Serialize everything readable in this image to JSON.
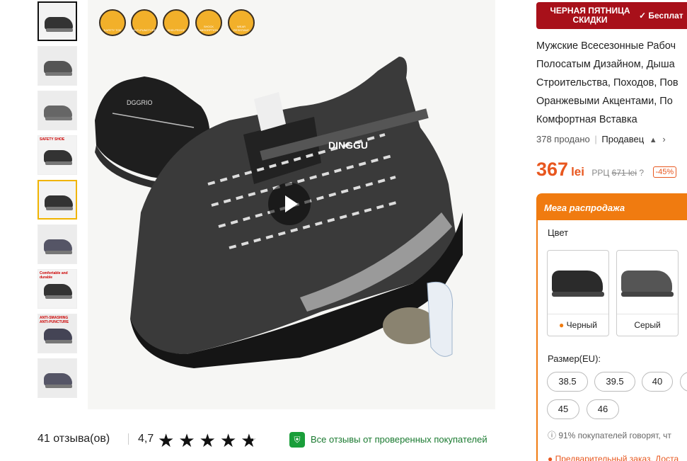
{
  "thumbnails": [
    {
      "label": ""
    },
    {
      "label": ""
    },
    {
      "label": ""
    },
    {
      "label": "SAFETY SHOE"
    },
    {
      "label": ""
    },
    {
      "label": ""
    },
    {
      "label": "Comfortable and durable"
    },
    {
      "label": "ANTI-SMASHING ANTI-PUNCTURE"
    },
    {
      "label": ""
    }
  ],
  "main_image": {
    "features": [
      "SAFETY TOE",
      "ANTI-PUNCTURE",
      "SKID-PROOF",
      "SHOCK ABSORPTION",
      "WEAR RESISTANT"
    ],
    "brand_text": "DINGGU"
  },
  "reviews": {
    "count_text": "41 отзыва(ов)",
    "rating": "4,7",
    "rating_value": 4.7,
    "verified_text": "Все отзывы от проверенных покупателей"
  },
  "promo": {
    "label": "ЧЕРНАЯ ПЯТНИЦА СКИДКИ",
    "benefit": "✓ Бесплат"
  },
  "product": {
    "title_lines": [
      "Мужские Всесезонные Рабоч",
      "Полосатым Дизайном, Дыша",
      "Строительства, Походов, Пов",
      "Оранжевыми Акцентами, По",
      "Комфортная Вставка"
    ],
    "sold": "378 продано",
    "seller": "Продавец",
    "price": "367",
    "currency": "lei",
    "rrp_label": "РРЦ",
    "old_price": "671 lei",
    "discount": "-45%"
  },
  "mega": {
    "title": "Мега распродажа",
    "color_label": "Цвет",
    "colors": [
      {
        "name": "Черный",
        "selected": false
      },
      {
        "name": "Серый",
        "selected": false
      }
    ],
    "size_label": "Размер(EU):",
    "sizes": [
      "38.5",
      "39.5",
      "40",
      "45",
      "46"
    ],
    "info": "ⓘ 91% покупателей говорят, чт",
    "preorder": "Предварительный заказ. Доста"
  },
  "colors": {
    "promo": "#a8101a",
    "mega": "#f07b10",
    "price": "#e8571f",
    "verified": "#1a9e3a"
  }
}
